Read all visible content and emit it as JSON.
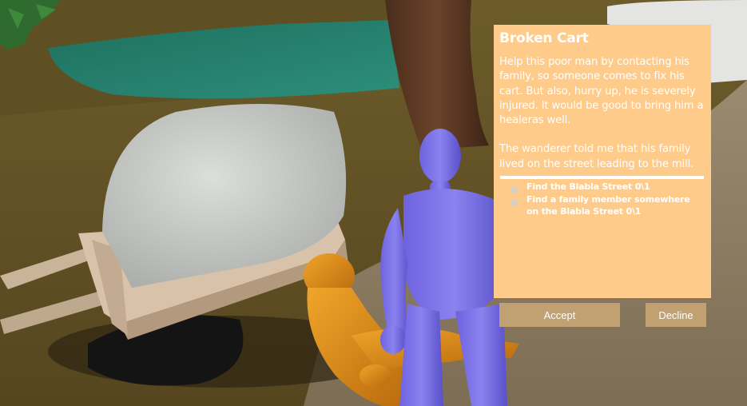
{
  "quest": {
    "title": "Broken Cart",
    "description": "Help this poor man by contacting his family, so someone comes to fix his cart. But also, hurry up, he is severely injured. It would be good to  bring him a healeras well.",
    "note": "The wanderer told me that his family lived on the street leading to the mill.",
    "objectives": [
      {
        "text": "Find the Blabla Street 0\\1",
        "done": false
      },
      {
        "text": "Find a family member somewhere on the Blabla Street 0\\1",
        "done": false
      }
    ]
  },
  "actions": {
    "accept_label": "Accept",
    "decline_label": "Decline"
  },
  "colors": {
    "panel": "#fecb8a",
    "button": "#c1a072",
    "text": "#ffffff"
  }
}
